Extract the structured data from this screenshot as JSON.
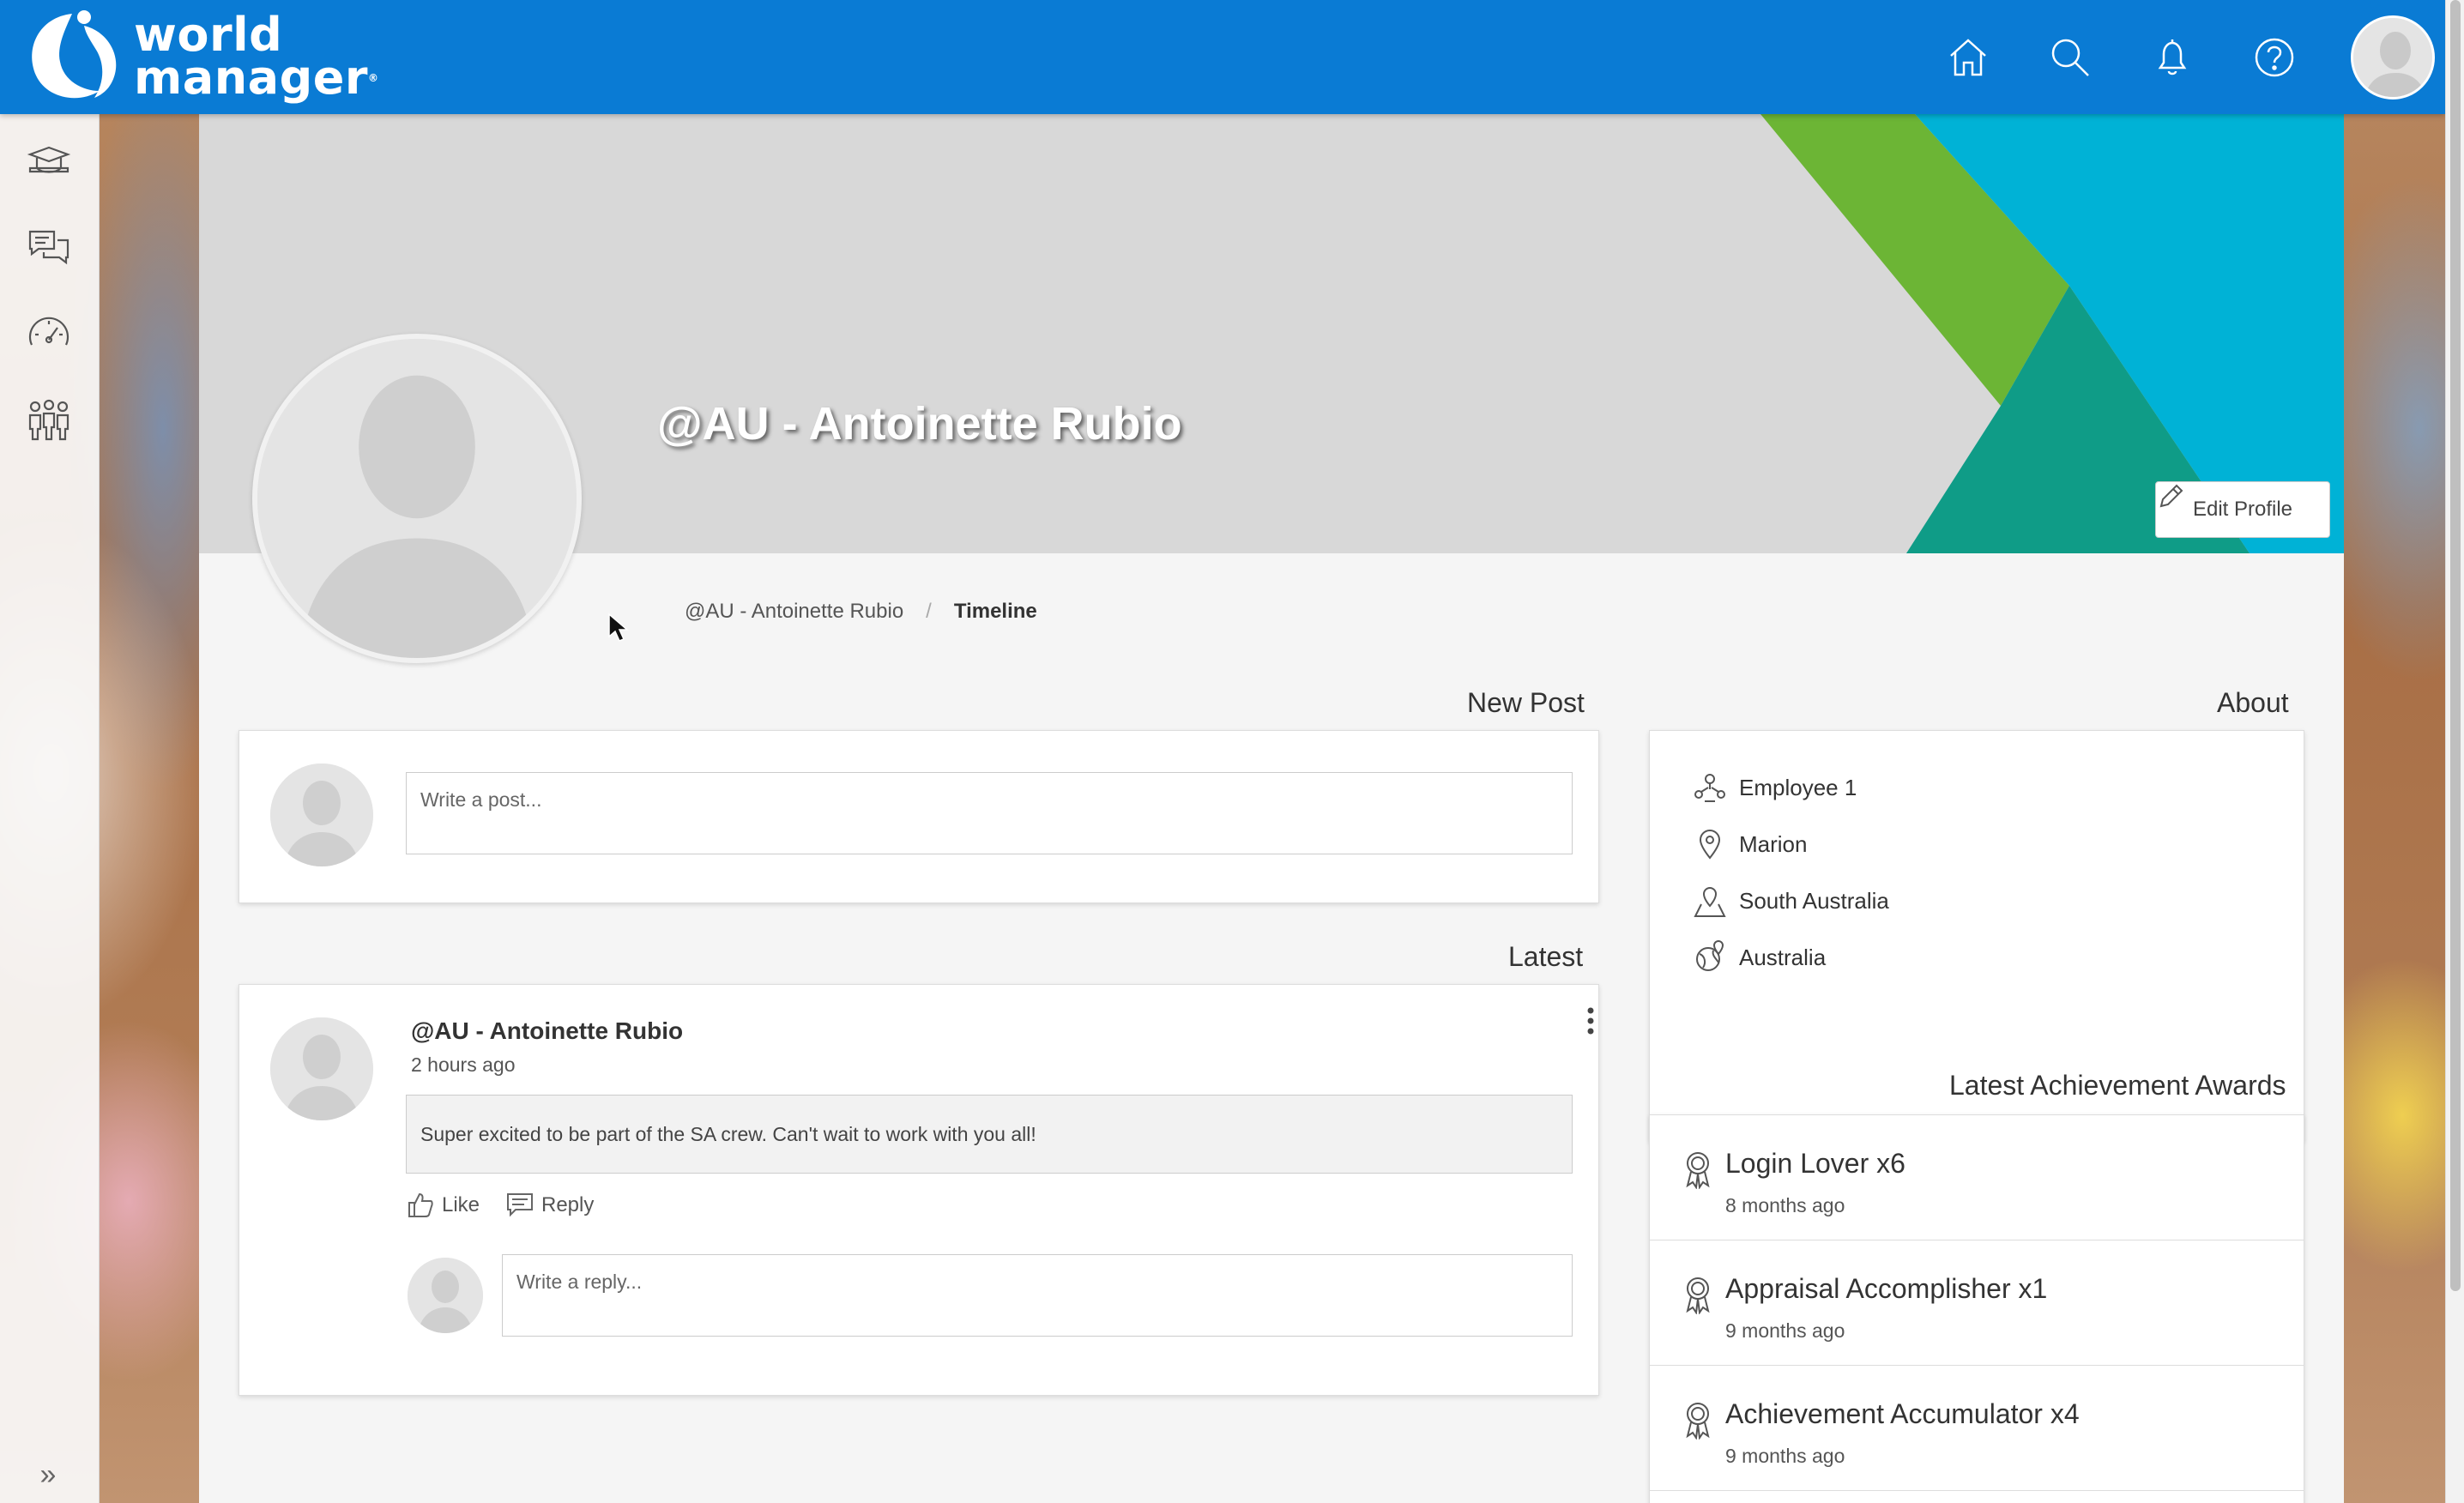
{
  "header": {
    "logo_line1": "world",
    "logo_line2": "manager",
    "logo_trademark": "®",
    "icons": [
      "home-icon",
      "search-icon",
      "bell-icon",
      "help-icon"
    ]
  },
  "sidebar": {
    "items": [
      "training-icon",
      "chat-icon",
      "dashboard-gauge-icon",
      "people-icon"
    ],
    "expand_label": "»"
  },
  "profile": {
    "name": "@AU - Antoinette Rubio",
    "edit_label": "Edit Profile"
  },
  "breadcrumb": {
    "parent": "@AU - Antoinette Rubio",
    "separator": "/",
    "current": "Timeline"
  },
  "new_post": {
    "title": "New Post",
    "placeholder": "Write a post..."
  },
  "latest": {
    "title": "Latest",
    "post": {
      "author": "@AU - Antoinette Rubio",
      "time": "2 hours ago",
      "body": "Super excited to be part of the SA crew. Can't wait to work with you all!",
      "like_label": "Like",
      "reply_label": "Reply",
      "reply_placeholder": "Write a reply..."
    }
  },
  "about": {
    "title": "About",
    "items": [
      {
        "icon": "org-role-icon",
        "text": "Employee 1"
      },
      {
        "icon": "location-pin-icon",
        "text": "Marion"
      },
      {
        "icon": "map-region-icon",
        "text": "South Australia"
      },
      {
        "icon": "globe-pin-icon",
        "text": "Australia"
      }
    ]
  },
  "awards": {
    "title": "Latest Achievement Awards",
    "items": [
      {
        "name": "Login Lover x6",
        "time": "8 months ago"
      },
      {
        "name": "Appraisal Accomplisher x1",
        "time": "9 months ago"
      },
      {
        "name": "Achievement Accumulator x4",
        "time": "9 months ago"
      }
    ]
  },
  "colors": {
    "topbar": "#0a7bd4",
    "cover_green": "#6cb535",
    "cover_cyan": "#00b2d6",
    "cover_teal": "#0f9c87"
  }
}
